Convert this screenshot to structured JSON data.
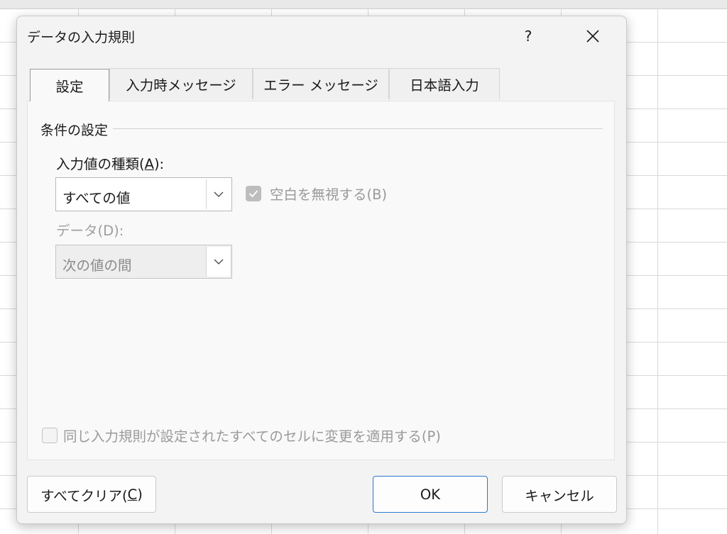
{
  "dialog": {
    "title": "データの入力規則",
    "help_label": "?",
    "tabs": [
      {
        "label": "設定",
        "active": true
      },
      {
        "label": "入力時メッセージ",
        "active": false
      },
      {
        "label": "エラー メッセージ",
        "active": false
      },
      {
        "label": "日本語入力",
        "active": false
      }
    ],
    "settings": {
      "group_title": "条件の設定",
      "allow_label_pre": "入力値の種類(",
      "allow_label_key": "A",
      "allow_label_post": "):",
      "allow_value": "すべての値",
      "ignore_blank_label": "空白を無視する(B)",
      "ignore_blank_checked": true,
      "ignore_blank_enabled": false,
      "data_label": "データ(D):",
      "data_value": "次の値の間",
      "data_enabled": false,
      "apply_all_label": "同じ入力規則が設定されたすべてのセルに変更を適用する(P)",
      "apply_all_checked": false
    },
    "buttons": {
      "clear_pre": "すべてクリア(",
      "clear_key": "C",
      "clear_post": ")",
      "ok": "OK",
      "cancel": "キャンセル"
    }
  },
  "colors": {
    "dialog_bg": "#f3f3f3",
    "panel_bg": "#f9f9f9",
    "accent": "#2a7ad0",
    "disabled_text": "#9a9a9a"
  }
}
